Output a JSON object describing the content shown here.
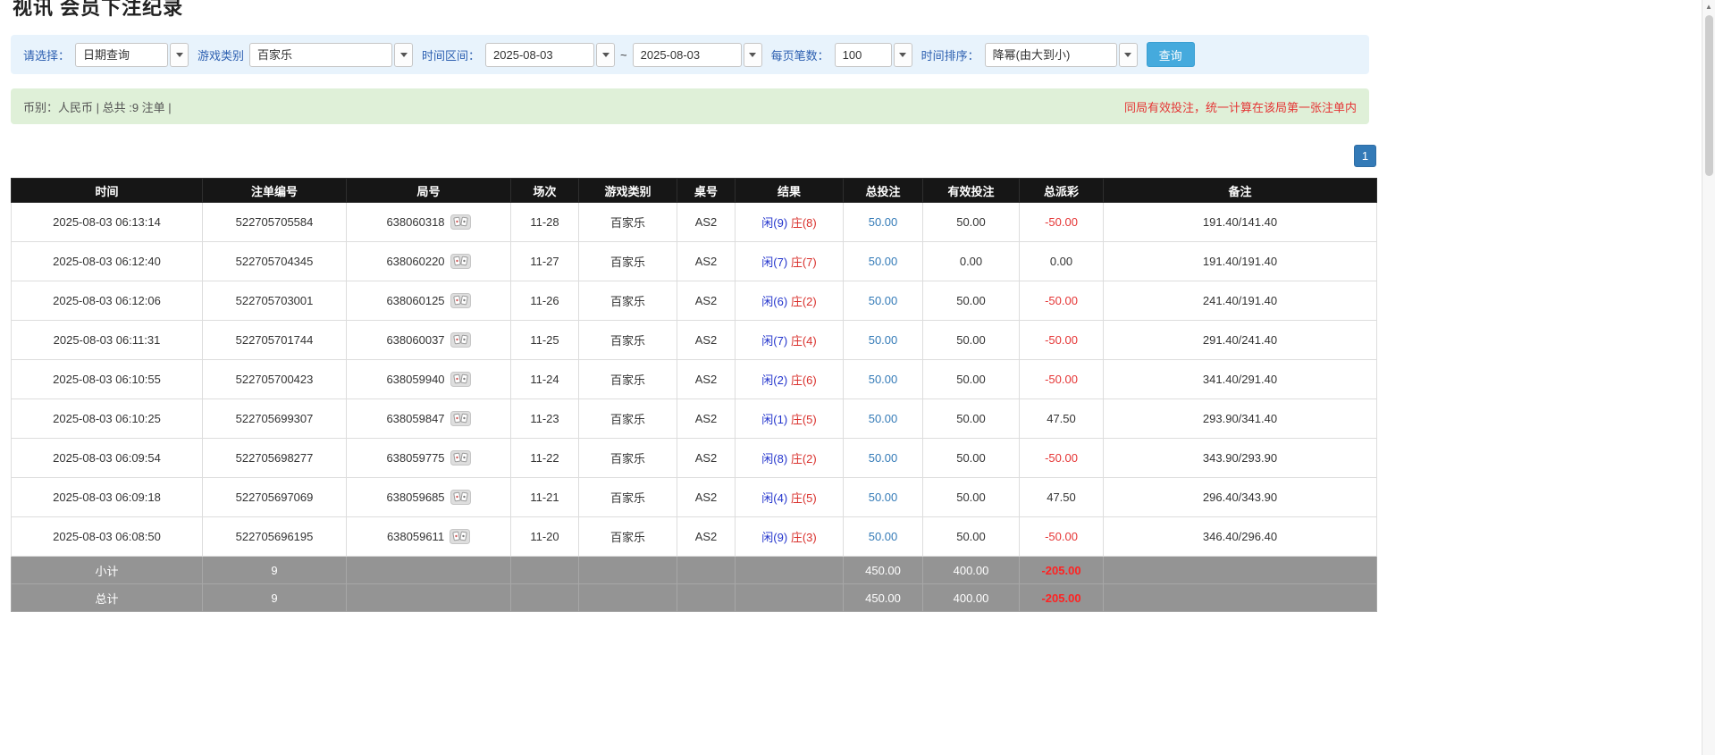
{
  "page": {
    "title": "视讯 会员下注纪录"
  },
  "filters": {
    "query_type_label": "请选择：",
    "query_type_value": "日期查询",
    "game_type_label": "游戏类别",
    "game_type_value": "百家乐",
    "time_range_label": "时间区间：",
    "date_from": "2025-08-03",
    "date_separator": "~",
    "date_to": "2025-08-03",
    "per_page_label": "每页笔数：",
    "per_page_value": "100",
    "sort_label": "时间排序：",
    "sort_value": "降幂(由大到小)",
    "search_button_label": "查询"
  },
  "summary": {
    "left_text": "币别：人民币 | 总共 :9 注单 |",
    "right_text": "同局有效投注，统一计算在该局第一张注单内"
  },
  "pagination": {
    "page": "1"
  },
  "table": {
    "headers": [
      "时间",
      "注单编号",
      "局号",
      "场次",
      "游戏类别",
      "桌号",
      "结果",
      "总投注",
      "有效投注",
      "总派彩",
      "备注"
    ],
    "rows": [
      {
        "time": "2025-08-03 06:13:14",
        "bet_id": "522705705584",
        "round_no": "638060318",
        "session": "11-28",
        "game": "百家乐",
        "table_no": "AS2",
        "result_player": "闲(9)",
        "result_banker": "庄(8)",
        "total_bet": "50.00",
        "valid_bet": "50.00",
        "payout": "-50.00",
        "note": "191.40/141.40"
      },
      {
        "time": "2025-08-03 06:12:40",
        "bet_id": "522705704345",
        "round_no": "638060220",
        "session": "11-27",
        "game": "百家乐",
        "table_no": "AS2",
        "result_player": "闲(7)",
        "result_banker": "庄(7)",
        "total_bet": "50.00",
        "valid_bet": "0.00",
        "payout": "0.00",
        "note": "191.40/191.40"
      },
      {
        "time": "2025-08-03 06:12:06",
        "bet_id": "522705703001",
        "round_no": "638060125",
        "session": "11-26",
        "game": "百家乐",
        "table_no": "AS2",
        "result_player": "闲(6)",
        "result_banker": "庄(2)",
        "total_bet": "50.00",
        "valid_bet": "50.00",
        "payout": "-50.00",
        "note": "241.40/191.40"
      },
      {
        "time": "2025-08-03 06:11:31",
        "bet_id": "522705701744",
        "round_no": "638060037",
        "session": "11-25",
        "game": "百家乐",
        "table_no": "AS2",
        "result_player": "闲(7)",
        "result_banker": "庄(4)",
        "total_bet": "50.00",
        "valid_bet": "50.00",
        "payout": "-50.00",
        "note": "291.40/241.40"
      },
      {
        "time": "2025-08-03 06:10:55",
        "bet_id": "522705700423",
        "round_no": "638059940",
        "session": "11-24",
        "game": "百家乐",
        "table_no": "AS2",
        "result_player": "闲(2)",
        "result_banker": "庄(6)",
        "total_bet": "50.00",
        "valid_bet": "50.00",
        "payout": "-50.00",
        "note": "341.40/291.40"
      },
      {
        "time": "2025-08-03 06:10:25",
        "bet_id": "522705699307",
        "round_no": "638059847",
        "session": "11-23",
        "game": "百家乐",
        "table_no": "AS2",
        "result_player": "闲(1)",
        "result_banker": "庄(5)",
        "total_bet": "50.00",
        "valid_bet": "50.00",
        "payout": "47.50",
        "note": "293.90/341.40"
      },
      {
        "time": "2025-08-03 06:09:54",
        "bet_id": "522705698277",
        "round_no": "638059775",
        "session": "11-22",
        "game": "百家乐",
        "table_no": "AS2",
        "result_player": "闲(8)",
        "result_banker": "庄(2)",
        "total_bet": "50.00",
        "valid_bet": "50.00",
        "payout": "-50.00",
        "note": "343.90/293.90"
      },
      {
        "time": "2025-08-03 06:09:18",
        "bet_id": "522705697069",
        "round_no": "638059685",
        "session": "11-21",
        "game": "百家乐",
        "table_no": "AS2",
        "result_player": "闲(4)",
        "result_banker": "庄(5)",
        "total_bet": "50.00",
        "valid_bet": "50.00",
        "payout": "47.50",
        "note": "296.40/343.90"
      },
      {
        "time": "2025-08-03 06:08:50",
        "bet_id": "522705696195",
        "round_no": "638059611",
        "session": "11-20",
        "game": "百家乐",
        "table_no": "AS2",
        "result_player": "闲(9)",
        "result_banker": "庄(3)",
        "total_bet": "50.00",
        "valid_bet": "50.00",
        "payout": "-50.00",
        "note": "346.40/296.40"
      }
    ],
    "footer_rows": [
      {
        "label": "小计",
        "count": "9",
        "total_bet": "450.00",
        "valid_bet": "400.00",
        "payout": "-205.00"
      },
      {
        "label": "总计",
        "count": "9",
        "total_bet": "450.00",
        "valid_bet": "400.00",
        "payout": "-205.00"
      }
    ]
  },
  "colors": {
    "accent_blue": "#337ab7",
    "player_blue": "#2233cc",
    "banker_red": "#d9302c",
    "negative_red": "#e53535",
    "header_bg": "#161616",
    "footer_bg": "#949494",
    "alert_bg": "#dff0d8",
    "filter_bg": "#e8f3fc",
    "search_button_bg": "#45aadd"
  }
}
